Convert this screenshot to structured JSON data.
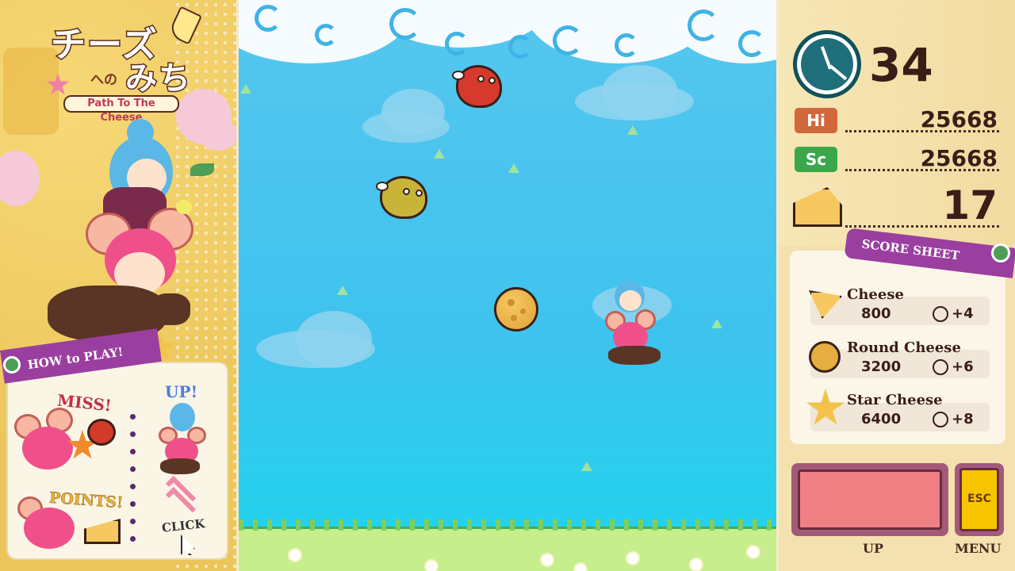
{
  "game": {
    "logo": {
      "title_jp_line1": "チーズ",
      "title_jp_line2": "みち",
      "title_jp_particle": "への",
      "title_en": "Path To The Cheese"
    }
  },
  "how_to_play": {
    "banner": "HOW to PLAY!",
    "miss_label": "MISS!",
    "points_label": "POINTS!",
    "up_label": "UP!",
    "click_label": "CLICK"
  },
  "hud": {
    "timer": "34",
    "hi_label": "Hi",
    "hi_score": "25668",
    "sc_label": "Sc",
    "score": "25668",
    "cheese_count": "17"
  },
  "score_sheet": {
    "title": "SCORE SHEET",
    "items": [
      {
        "name": "Cheese",
        "points": "800",
        "time": "+4",
        "icon": "cheese-wedge-icon"
      },
      {
        "name": "Round Cheese",
        "points": "3200",
        "time": "+6",
        "icon": "round-cheese-icon"
      },
      {
        "name": "Star Cheese",
        "points": "6400",
        "time": "+8",
        "icon": "star-cheese-icon"
      }
    ]
  },
  "controls": {
    "up_button_label": "UP",
    "menu_button_key": "ESC",
    "menu_button_label": "MENU"
  },
  "colors": {
    "sky": "#3dc3ee",
    "hi_tag": "#d0683c",
    "sc_tag": "#3aa74c",
    "banner": "#9a3fa0",
    "up_button": "#f08084",
    "esc_button": "#f7c400"
  }
}
